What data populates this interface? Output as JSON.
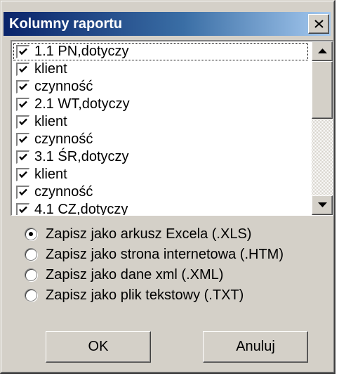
{
  "window": {
    "title": "Kolumny raportu",
    "close_icon": "close-icon"
  },
  "columns": [
    {
      "label": "1.1 PN,dotyczy",
      "checked": true
    },
    {
      "label": "klient",
      "checked": true
    },
    {
      "label": "czynność",
      "checked": true
    },
    {
      "label": "2.1 WT,dotyczy",
      "checked": true
    },
    {
      "label": "klient",
      "checked": true
    },
    {
      "label": "czynność",
      "checked": true
    },
    {
      "label": "3.1 ŚR,dotyczy",
      "checked": true
    },
    {
      "label": "klient",
      "checked": true
    },
    {
      "label": "czynność",
      "checked": true
    },
    {
      "label": "4.1 CZ,dotyczy",
      "checked": true
    }
  ],
  "export_options": [
    {
      "label": "Zapisz jako arkusz Excela (.XLS)",
      "selected": true
    },
    {
      "label": "Zapisz jako strona internetowa (.HTM)",
      "selected": false
    },
    {
      "label": "Zapisz jako dane xml (.XML)",
      "selected": false
    },
    {
      "label": "Zapisz jako plik tekstowy (.TXT)",
      "selected": false
    }
  ],
  "buttons": {
    "ok": "OK",
    "cancel": "Anuluj"
  }
}
